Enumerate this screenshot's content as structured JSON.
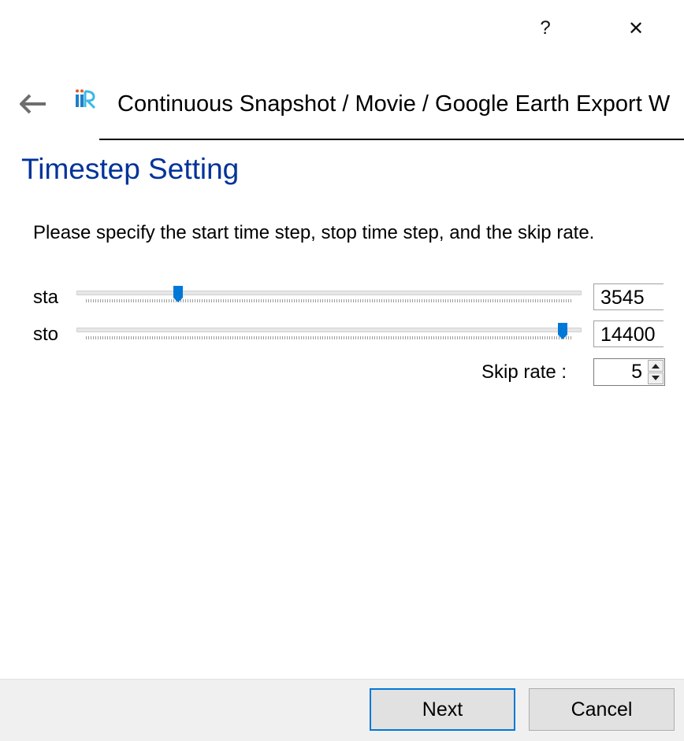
{
  "titlebar": {
    "help_symbol": "?",
    "close_symbol": "✕"
  },
  "header": {
    "wizard_title": "Continuous Snapshot / Movie / Google Earth Export W"
  },
  "page": {
    "title": "Timestep Setting",
    "instructions": "Please specify the start time step, stop time step, and the skip rate."
  },
  "start_row": {
    "label": "sta",
    "value": "3545",
    "slider_fraction": 0.19
  },
  "stop_row": {
    "label": "sto",
    "value": "14400",
    "slider_fraction": 0.98
  },
  "skip": {
    "label": "Skip rate :",
    "value": "5"
  },
  "footer": {
    "next_label": "Next",
    "cancel_label": "Cancel"
  },
  "icons": {
    "back": "arrow-left-icon",
    "logo": "app-logo-icon",
    "help": "help-icon",
    "close": "close-icon"
  },
  "colors": {
    "accent": "#0078d7",
    "title_blue": "#003399"
  }
}
